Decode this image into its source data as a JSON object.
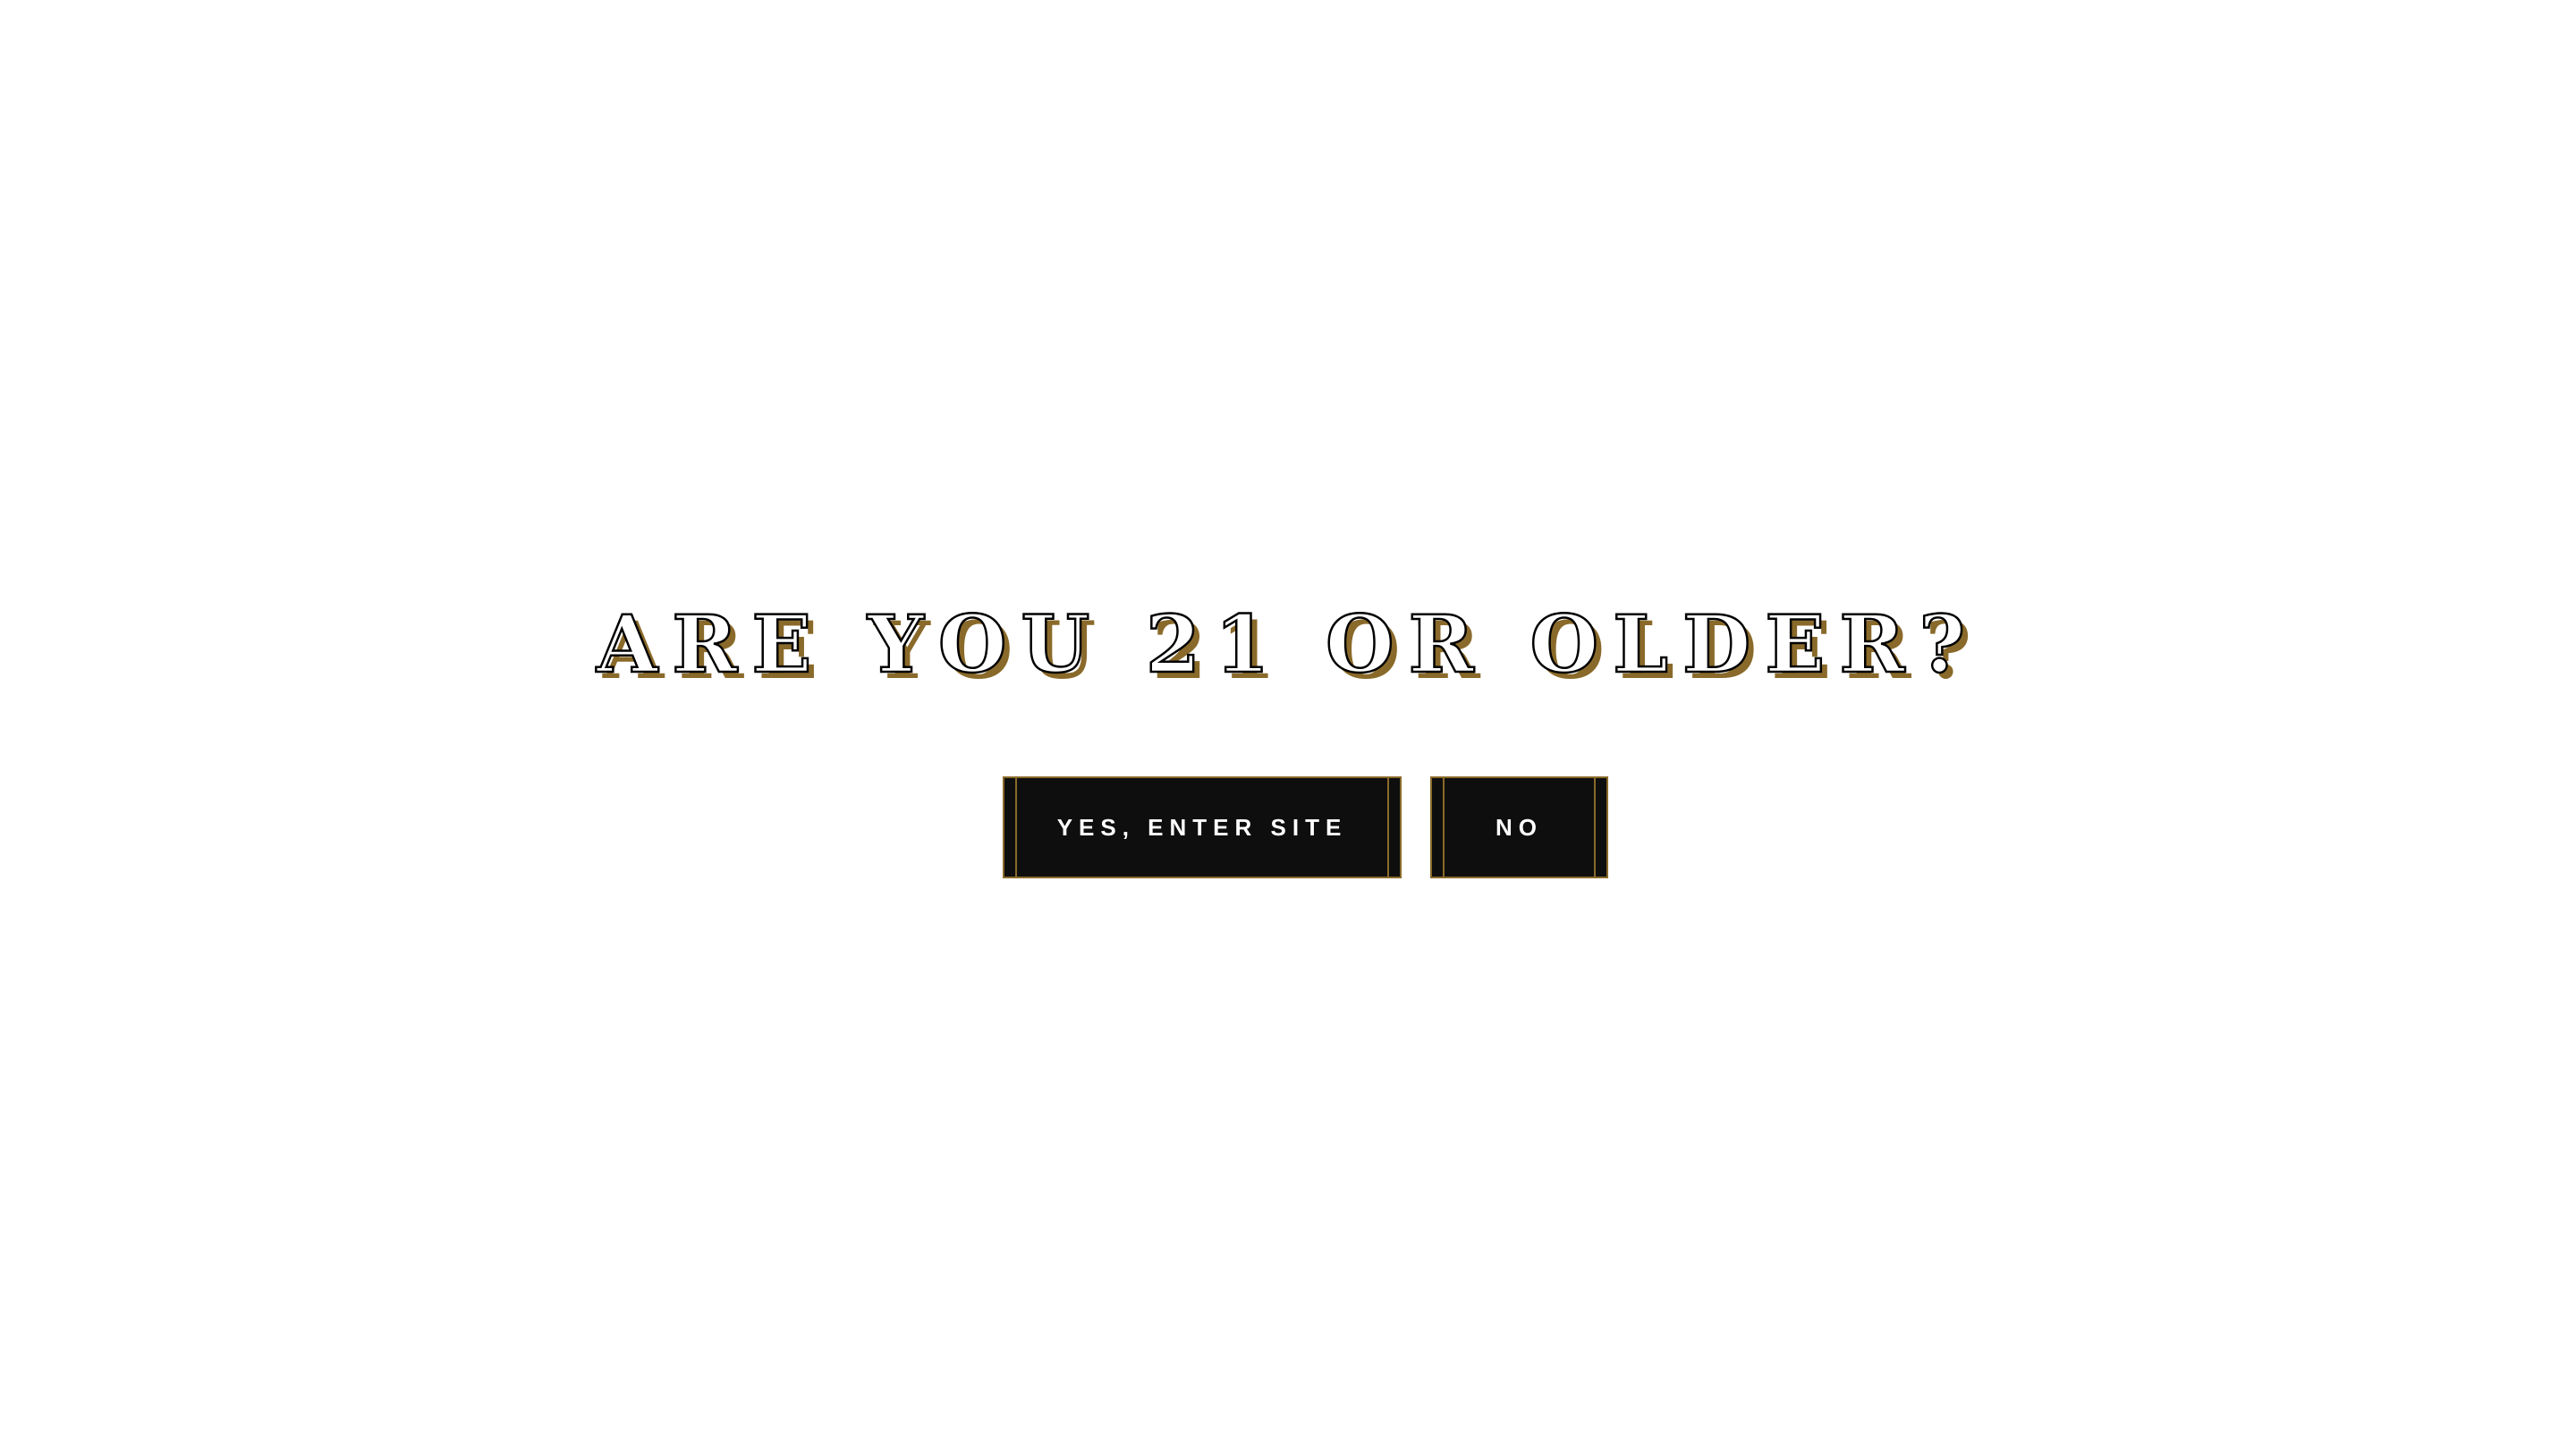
{
  "age_gate": {
    "question": "ARE YOU 21 OR OLDER?",
    "yes_label": "YES, ENTER SITE",
    "no_label": "NO"
  },
  "colors": {
    "background": "#ffffff",
    "button_fill": "#0e0e0e",
    "accent_gold": "#8a6a2a",
    "text_light": "#ffffff"
  }
}
